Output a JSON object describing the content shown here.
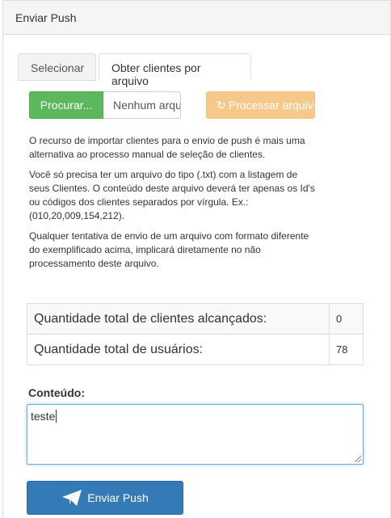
{
  "panel": {
    "title": "Enviar Push"
  },
  "tabs": [
    {
      "label": "Selecionar"
    },
    {
      "label": "Obter clientes por arquivo"
    }
  ],
  "file_upload": {
    "browse_label": "Procurar...",
    "file_name": "Nenhum arquivo selecionado.",
    "process_label": "Processar arquivo",
    "process_icon": "refresh-icon"
  },
  "info": {
    "p1": "O recurso de importar clientes para o envio de push é mais uma alternativa ao processo manual de seleção de clientes.",
    "p2": "Você só precisa ter um arquivo do tipo (.txt) com a listagem de seus Clientes. O conteúdo deste arquivo deverá ter apenas os Id's ou códigos dos clientes separados por vírgula. Ex.: (010,20,009,154,212).",
    "p3": "Qualquer tentativa de envio de um arquivo com formato diferente do exemplificado acima, implicará diretamente no não processamento deste arquivo."
  },
  "stats": [
    {
      "label": "Quantidade total de clientes alcançados:",
      "value": "0"
    },
    {
      "label": "Quantidade total de usuários:",
      "value": "78"
    }
  ],
  "content": {
    "label": "Conteúdo:",
    "value": "teste"
  },
  "send_button": {
    "label": "Enviar Push",
    "icon": "paper-plane-icon"
  },
  "colors": {
    "success": "#5cb85c",
    "warning_disabled": "#f6c98a",
    "primary": "#337ab7"
  }
}
